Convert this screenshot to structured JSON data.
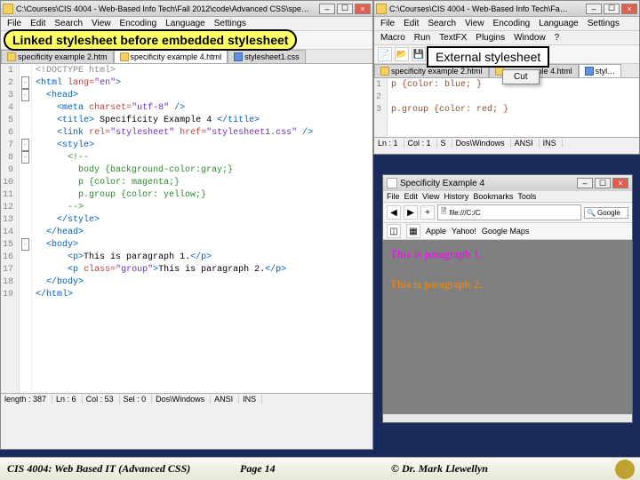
{
  "labels": {
    "linked": "Linked stylesheet before embedded stylesheet",
    "external": "External stylesheet"
  },
  "context_menu": {
    "cut": "Cut"
  },
  "editor_left": {
    "title": "C:\\Courses\\CIS 4004 - Web-Based Info Tech\\Fall 2012\\code\\Advanced CSS\\spe…",
    "menu": [
      "File",
      "Edit",
      "Search",
      "View",
      "Encoding",
      "Language",
      "Settings"
    ],
    "tabs": [
      {
        "label": "specificity example 2.htm",
        "type": "html"
      },
      {
        "label": "specificity example 4.html",
        "type": "html",
        "active": true
      },
      {
        "label": "stylesheet1.css",
        "type": "css"
      }
    ],
    "code": [
      {
        "n": 1,
        "f": "",
        "s": "",
        "h": "<span class='c-gray'>&lt;!DOCTYPE html&gt;</span>"
      },
      {
        "n": 2,
        "f": "-",
        "s": "",
        "h": "<span class='c-blue'>&lt;html</span> <span class='c-red'>lang=</span><span class='c-purple'>\"en\"</span><span class='c-blue'>&gt;</span>"
      },
      {
        "n": 3,
        "f": "-",
        "s": "  ",
        "h": "<span class='c-blue'>&lt;head&gt;</span>"
      },
      {
        "n": 4,
        "f": "",
        "s": "    ",
        "h": "<span class='c-blue'>&lt;meta</span> <span class='c-red'>charset=</span><span class='c-purple'>\"utf-8\"</span> <span class='c-blue'>/&gt;</span>"
      },
      {
        "n": 5,
        "f": "",
        "s": "    ",
        "h": "<span class='c-blue'>&lt;title&gt;</span><span class='c-black'> Specificity Example 4 </span><span class='c-blue'>&lt;/title&gt;</span>"
      },
      {
        "n": 6,
        "f": "",
        "s": "    ",
        "h": "<span class='c-blue'>&lt;link</span> <span class='c-red'>rel=</span><span class='c-purple'>\"stylesheet\"</span> <span class='c-red'>href=</span><span class='c-purple'>\"stylesheet1.css\"</span> <span class='c-blue'>/&gt;</span>"
      },
      {
        "n": 7,
        "f": "-",
        "s": "    ",
        "h": "<span class='c-blue'>&lt;style&gt;</span>"
      },
      {
        "n": 8,
        "f": "-",
        "s": "      ",
        "h": "<span class='c-green'>&lt;!--</span>"
      },
      {
        "n": 9,
        "f": "",
        "s": "        ",
        "h": "<span class='c-green'>body {background-color:gray;}</span>"
      },
      {
        "n": 10,
        "f": "",
        "s": "        ",
        "h": "<span class='c-green'>p {color: magenta;}</span>"
      },
      {
        "n": 11,
        "f": "",
        "s": "        ",
        "h": "<span class='c-green'>p.group {color: yellow;}</span>"
      },
      {
        "n": 12,
        "f": "",
        "s": "      ",
        "h": "<span class='c-green'>--&gt;</span>"
      },
      {
        "n": 13,
        "f": "",
        "s": "    ",
        "h": "<span class='c-blue'>&lt;/style&gt;</span>"
      },
      {
        "n": 14,
        "f": "",
        "s": "  ",
        "h": "<span class='c-blue'>&lt;/head&gt;</span>"
      },
      {
        "n": 15,
        "f": "-",
        "s": "  ",
        "h": "<span class='c-blue'>&lt;body&gt;</span>"
      },
      {
        "n": 16,
        "f": "",
        "s": "      ",
        "h": "<span class='c-blue'>&lt;p&gt;</span><span class='c-black'>This is paragraph 1.</span><span class='c-blue'>&lt;/p&gt;</span>"
      },
      {
        "n": 17,
        "f": "",
        "s": "      ",
        "h": "<span class='c-blue'>&lt;p</span> <span class='c-red'>class=</span><span class='c-purple'>\"group\"</span><span class='c-blue'>&gt;</span><span class='c-black'>This is paragraph 2.</span><span class='c-blue'>&lt;/p&gt;</span>"
      },
      {
        "n": 18,
        "f": "",
        "s": "  ",
        "h": "<span class='c-blue'>&lt;/body&gt;</span>"
      },
      {
        "n": 19,
        "f": "",
        "s": "",
        "h": "<span class='c-blue'>&lt;/html&gt;</span>"
      }
    ],
    "status": {
      "length": "length : 387",
      "ln": "Ln : 6",
      "col": "Col : 53",
      "sel": "Sel : 0",
      "fmt": "Dos\\Windows",
      "enc": "ANSI",
      "mode": "INS"
    }
  },
  "editor_right": {
    "title": "C:\\Courses\\CIS 4004 - Web-Based Info Tech\\Fa…",
    "menu": [
      "File",
      "Edit",
      "Search",
      "View",
      "Encoding",
      "Language",
      "Settings"
    ],
    "menu2": [
      "Macro",
      "Run",
      "TextFX",
      "Plugins",
      "Window",
      "?"
    ],
    "tabs": [
      {
        "label": "specificity example 2.html",
        "type": "html"
      },
      {
        "label": "spe…ample 4.html",
        "type": "html"
      },
      {
        "label": "styl…",
        "type": "css",
        "active": true
      }
    ],
    "code": [
      {
        "n": 1,
        "h": "<span class='c-brown'>p {color: blue; }</span>"
      },
      {
        "n": 2,
        "h": ""
      },
      {
        "n": 3,
        "h": "<span class='c-brown'>p.group {color: red; }</span>"
      }
    ],
    "status": {
      "ln": "Ln : 1",
      "col": "Col : 1",
      "s": "S",
      "fmt": "Dos\\Windows",
      "enc": "ANSI",
      "mode": "INS"
    }
  },
  "browser": {
    "title": "Specificity Example 4",
    "menu": [
      "File",
      "Edit",
      "View",
      "History",
      "Bookmarks",
      "Tools"
    ],
    "addr": "file:///C:/C",
    "search_engine": "Google",
    "bookmarks": [
      "Apple",
      "Yahoo!",
      "Google Maps"
    ],
    "para1": "This is paragraph 1.",
    "para2": "This is paragraph 2."
  },
  "footer": {
    "left": "CIS 4004: Web Based IT (Advanced CSS)",
    "mid": "Page 14",
    "right": "© Dr. Mark Llewellyn"
  }
}
